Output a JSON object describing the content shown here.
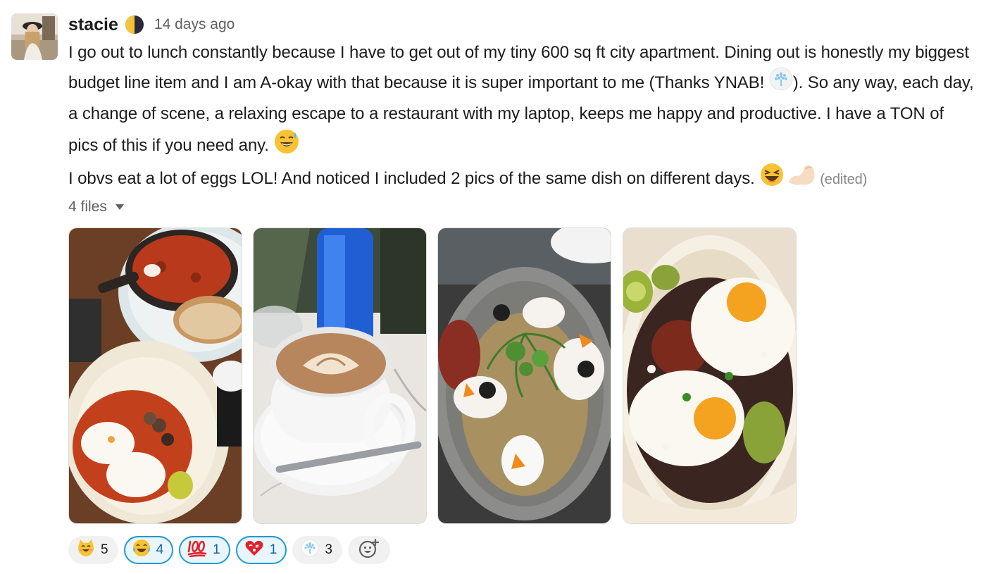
{
  "message": {
    "author": "stacie",
    "timestamp": "14 days ago",
    "paragraph1": [
      "I go out to lunch constantly because I have to get out of my tiny 600 sq ft city apartment. Dining out is honestly my biggest budget line item and I am A-okay with that because it is super important to me (Thanks YNAB! ",
      "). So any way, each day, a change of scene, a relaxing escape to a restaurant with my laptop, keeps me happy and productive. I have a TON of pics of this if you need any. "
    ],
    "paragraph2": "I obvs eat a lot of eggs LOL! And noticed I included 2 pics of the same dish on different days. ",
    "edited": "(edited)"
  },
  "files": {
    "label": "4 files",
    "items": [
      {
        "name": "shakshuka-and-huevos"
      },
      {
        "name": "cappuccino"
      },
      {
        "name": "poached-egg-toast"
      },
      {
        "name": "huevos-rancheros"
      }
    ]
  },
  "reactions": [
    {
      "icon": "smiling-cat-icon",
      "count": "5",
      "mine": false
    },
    {
      "icon": "joy-icon",
      "count": "4",
      "mine": true
    },
    {
      "icon": "hundred-icon",
      "count": "1",
      "mine": true
    },
    {
      "icon": "heart-kiss-icon",
      "count": "1",
      "mine": true
    },
    {
      "icon": "ynab-tree-icon",
      "count": "3",
      "mine": false
    }
  ],
  "colors": {
    "accent": "#1d9bd1",
    "mine_bg": "#e8f5fa",
    "reaction_bg": "#f1f1f1"
  }
}
